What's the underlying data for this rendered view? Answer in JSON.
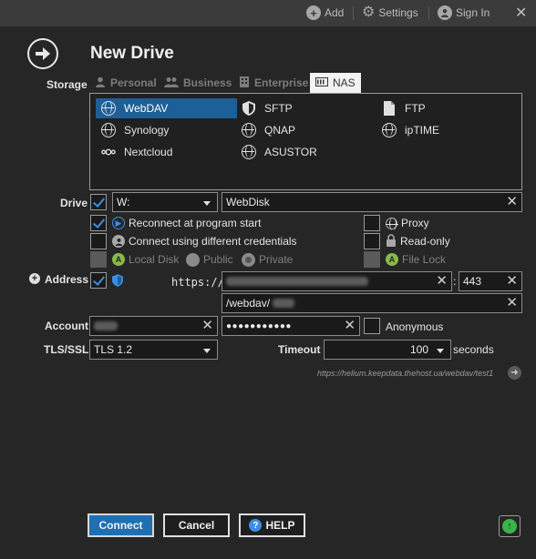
{
  "topbar": {
    "add_label": "Add",
    "settings_label": "Settings",
    "signin_label": "Sign In",
    "close_glyph": "✕"
  },
  "dialog": {
    "title": "New Drive"
  },
  "labels": {
    "storage": "Storage",
    "drive": "Drive",
    "address": "Address",
    "account": "Account",
    "tls": "TLS/SSL",
    "timeout": "Timeout",
    "seconds": "seconds"
  },
  "storage_tabs": [
    {
      "label": "Personal",
      "icon": "person-icon",
      "active": false
    },
    {
      "label": "Business",
      "icon": "people-icon",
      "active": false
    },
    {
      "label": "Enterprise",
      "icon": "building-icon",
      "active": false
    },
    {
      "label": "NAS",
      "icon": "nas-icon",
      "active": true
    }
  ],
  "protocols": [
    {
      "label": "WebDAV",
      "icon": "globe-icon",
      "selected": true
    },
    {
      "label": "SFTP",
      "icon": "shield-icon",
      "selected": false
    },
    {
      "label": "FTP",
      "icon": "file-icon",
      "selected": false
    },
    {
      "label": "Synology",
      "icon": "globe-icon",
      "selected": false
    },
    {
      "label": "QNAP",
      "icon": "globe-icon",
      "selected": false
    },
    {
      "label": "ipTIME",
      "icon": "globe-icon",
      "selected": false
    },
    {
      "label": "Nextcloud",
      "icon": "nextcloud-icon",
      "selected": false
    },
    {
      "label": "ASUSTOR",
      "icon": "globe-icon",
      "selected": false
    }
  ],
  "drive": {
    "letter": "W:",
    "name": "WebDisk"
  },
  "options": {
    "reconnect": "Reconnect at program start",
    "different_credentials": "Connect using different credentials",
    "local_disk": "Local Disk",
    "public": "Public",
    "private": "Private",
    "proxy": "Proxy",
    "read_only": "Read-only",
    "file_lock": "File Lock"
  },
  "address": {
    "scheme": "https://",
    "port_separator": ":",
    "port": "443",
    "path": "/webdav/"
  },
  "account": {
    "password": "●●●●●●●●●●●",
    "anonymous": "Anonymous"
  },
  "tls": {
    "value": "TLS 1.2"
  },
  "timeout": {
    "value": "100"
  },
  "url_hint": "https://helium.keepdata.thehost.ua/webdav/test1",
  "buttons": {
    "connect": "Connect",
    "cancel": "Cancel",
    "help": "HELP"
  },
  "colors": {
    "accent": "#1f6fb3",
    "selection": "#1f5f97",
    "check": "#3a8ee6",
    "status_green": "#3bb44a"
  }
}
